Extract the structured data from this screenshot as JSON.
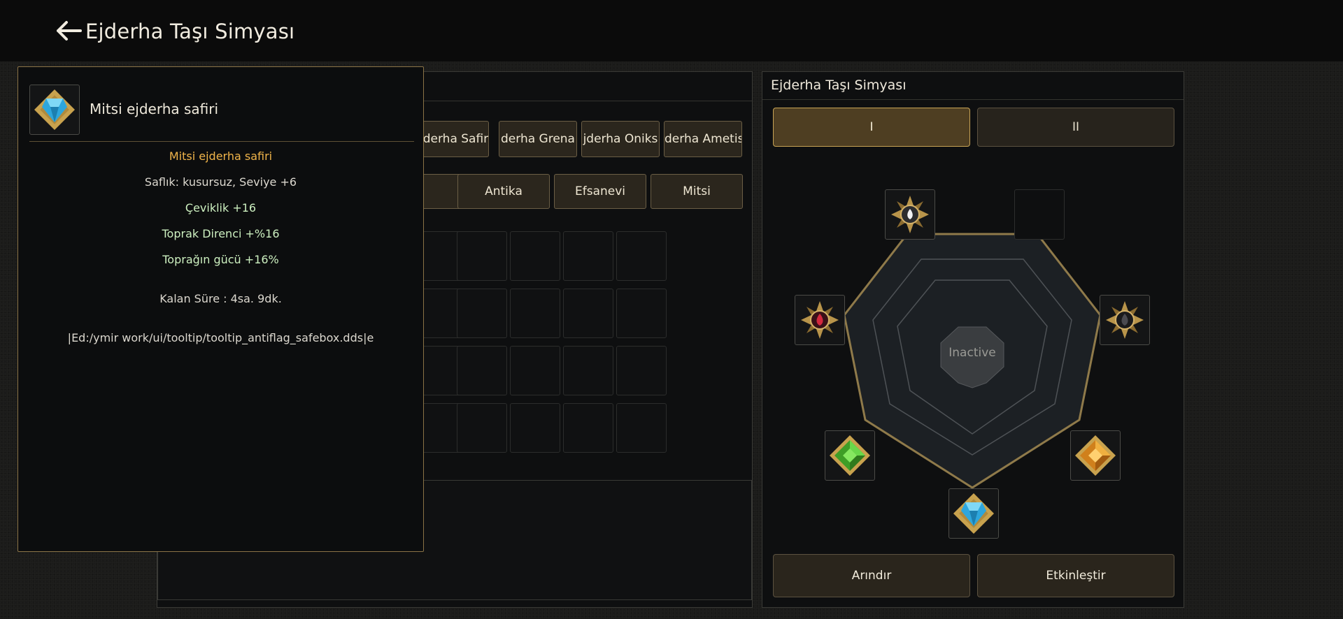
{
  "header": {
    "title": "Ejderha Taşı Simyası",
    "back_icon": "arrow-left-icon"
  },
  "inventory_panel": {
    "gem_tabs": [
      "jderha Safir",
      "derha Grena",
      "jderha Oniks",
      "derha Ametis"
    ],
    "rarity_buttons": [
      "",
      "Antika",
      "Efsanevi",
      "Mitsi"
    ]
  },
  "alchemy_panel": {
    "title": "Ejderha Taşı Simyası",
    "tabs": [
      "I",
      "II"
    ],
    "active_tab": "I",
    "center_status": "Inactive",
    "sockets": [
      {
        "slot": "top-left",
        "gem": "diamond",
        "color": "#dfe6ee"
      },
      {
        "slot": "top-right",
        "gem": "empty"
      },
      {
        "slot": "left",
        "gem": "ruby",
        "color": "#c0283c"
      },
      {
        "slot": "right",
        "gem": "onyx",
        "color": "#3a3a3e"
      },
      {
        "slot": "bottom-left",
        "gem": "jade",
        "color": "#4fc232"
      },
      {
        "slot": "bottom-right",
        "gem": "garnet",
        "color": "#e89a2a"
      },
      {
        "slot": "bottom",
        "gem": "sapphire",
        "color": "#35b8e6"
      }
    ],
    "buttons": {
      "refine": "Arındır",
      "activate": "Etkinleştir"
    }
  },
  "tooltip": {
    "item_name": "Mitsi ejderha safiri",
    "title": "Mitsi ejderha safiri",
    "purity": "Saflık: kusursuz, Seviye +6",
    "bonus_1": "Çeviklik +16",
    "bonus_2": "Toprak Direnci +%16",
    "bonus_3": "Toprağın gücü +16%",
    "time_left": "Kalan Süre : 4sa. 9dk.",
    "debug_path": "|Ed:/ymir work/ui/tooltip/tooltip_antiflag_safebox.dds|e"
  },
  "colors": {
    "accent_gold": "#c8a455",
    "tooltip_title": "#f0b44a",
    "bonus_green": "#cdf0c0"
  }
}
